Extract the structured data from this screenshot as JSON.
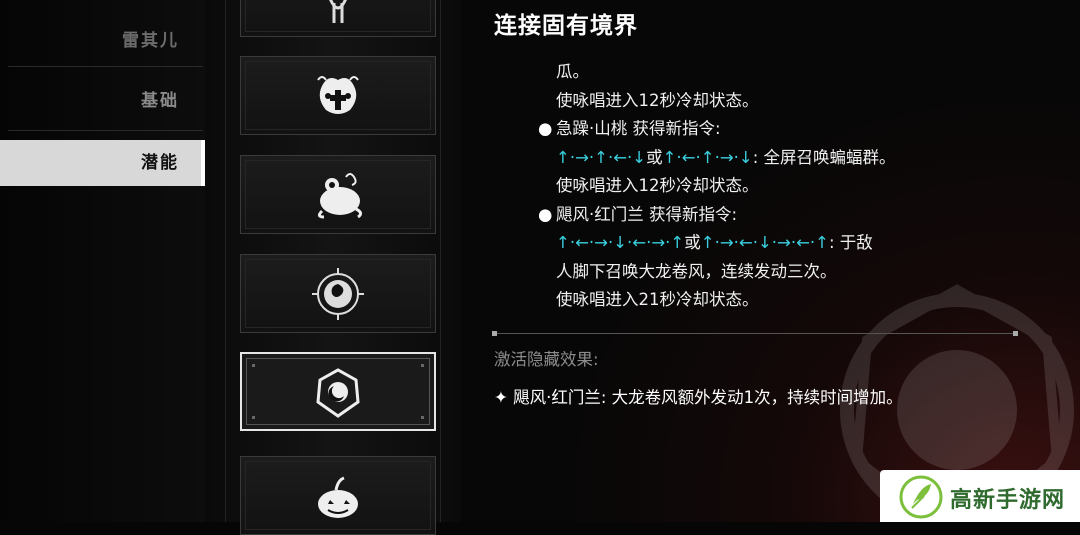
{
  "sidebar": {
    "items": [
      {
        "label": "雷其儿"
      },
      {
        "label": "基础"
      },
      {
        "label": "潜能"
      }
    ]
  },
  "icons": [
    {
      "name": "top-partial-icon"
    },
    {
      "name": "jack-o-lantern-cross-icon"
    },
    {
      "name": "toad-icon"
    },
    {
      "name": "rose-emblem-icon"
    },
    {
      "name": "crescent-emblem-icon"
    },
    {
      "name": "pumpkin-icon"
    }
  ],
  "detail": {
    "title": "连接固有境界",
    "lines": {
      "l1": "瓜。",
      "l2": "使咏唱进入12秒冷却状态。",
      "b1": "急躁·山桃 获得新指令:",
      "c1_arrows": "↑·→·↑·←·↓",
      "c1_or": "或",
      "c1_arrows2": "↑·←·↑·→·↓",
      "c1_rest": ": 全屏召唤蝙蝠群。",
      "l3": "使咏唱进入12秒冷却状态。",
      "b2": "飓风·红门兰 获得新指令:",
      "c2_arrows": "↑·←·→·↓·←·→·↑",
      "c2_or": "或",
      "c2_arrows2": "↑·→·←·↓·→·←·↑",
      "c2_rest": ": 于敌",
      "l4": "人脚下召唤大龙卷风，连续发动三次。",
      "l5": "使咏唱进入21秒冷却状态。"
    },
    "hidden_label": "激活隐藏效果:",
    "hidden_effect": "✦ 飓风·红门兰: 大龙卷风额外发动1次，持续时间增加。"
  },
  "watermark": {
    "text": "高新手游网"
  },
  "colors": {
    "arrow": "#3ad0e0",
    "accent": "#d8d8d8"
  }
}
